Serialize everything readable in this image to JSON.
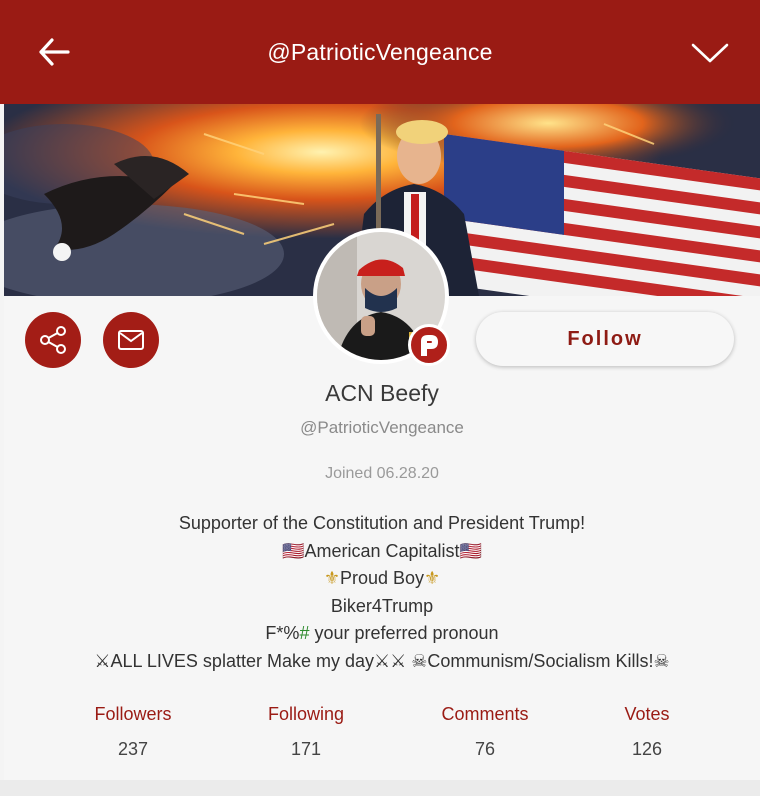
{
  "header": {
    "title": "@PatrioticVengeance",
    "back_icon": "arrow-left-icon",
    "menu_icon": "chevron-down-icon",
    "background": "#9a1b14"
  },
  "profile": {
    "display_name": "ACN Beefy",
    "handle": "@PatrioticVengeance",
    "joined": "Joined 06.28.20",
    "follow_label": "Follow",
    "badge_letter": "P",
    "bio": {
      "line1": "Supporter of the Constitution and President Trump!",
      "line2_flag_left": "🇺🇸",
      "line2_text": "American Capitalist",
      "line2_flag_right": "🇺🇸",
      "line3_icon_left": "⚜",
      "line3_text": "Proud Boy",
      "line3_icon_right": "⚜",
      "line4": "Biker4Trump",
      "line5_prefix": "F*%",
      "line5_hash": "#",
      "line5_suffix": " your preferred pronoun",
      "line6_part1": "⚔ALL LIVES splatter Make my day⚔⚔ ",
      "line6_part2": "☠Communism/Socialism Kills!☠"
    }
  },
  "stats": [
    {
      "label": "Followers",
      "value": "237"
    },
    {
      "label": "Following",
      "value": "171"
    },
    {
      "label": "Comments",
      "value": "76"
    },
    {
      "label": "Votes",
      "value": "126"
    }
  ],
  "colors": {
    "accent": "#a31d16",
    "stat_label": "#9a1b14"
  }
}
